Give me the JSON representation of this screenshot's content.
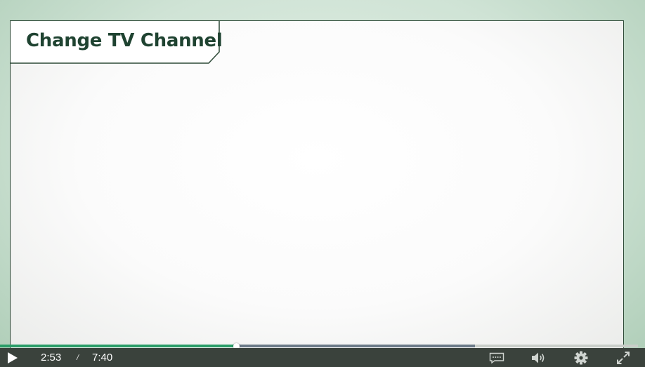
{
  "slide": {
    "title": "Change TV Channel"
  },
  "player": {
    "current_time": "2:53",
    "time_separator": "/",
    "duration": "7:40",
    "played_fraction": 0.37,
    "buffered_fraction": 0.745
  },
  "icons": {
    "play": "play-icon",
    "captions": "captions-icon",
    "volume": "volume-icon",
    "settings": "gear-icon",
    "fullscreen": "fullscreen-icon"
  },
  "colors": {
    "title_text": "#1f4331",
    "board_border": "#2d4a37",
    "progress_played": "#2a9d68",
    "progress_buffer": "#6b7a88",
    "controls_bg": "#3a423c"
  }
}
